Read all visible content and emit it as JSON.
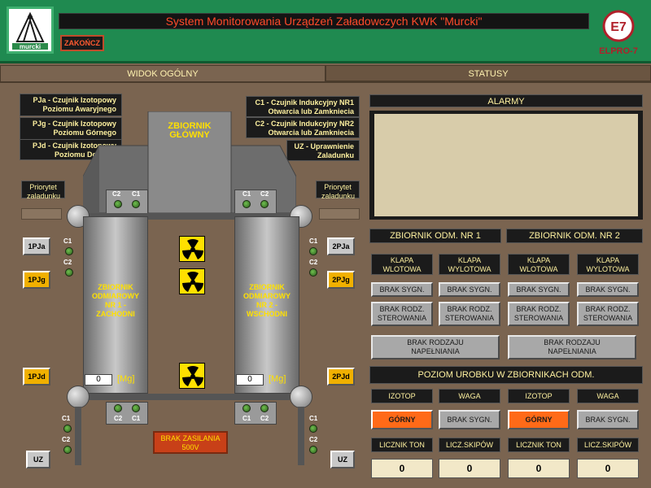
{
  "header": {
    "title": "System Monitorowania Urządzeń Załadowczych KWK \"Murcki\"",
    "exit_label": "ZAKOŃCZ",
    "logo_text": "murcki",
    "brand_logo_text": "ELPRO-7"
  },
  "tabs": [
    {
      "label": "WIDOK OGÓLNY",
      "active": true
    },
    {
      "label": "STATUSY",
      "active": false
    }
  ],
  "legend": {
    "pja": "PJa - Czujnik Izotopowy\nPoziomu Awaryjnego",
    "pjg": "PJg - Czujnik Izotopowy\nPoziomu Górnego",
    "pjd": "PJd - Czujnik Izotopowy\nPoziomu Dolnego",
    "c1": "C1 - Czujnik Indukcyjny NR1\nOtwarcia lub Zamkniecia",
    "c2": "C2 - Czujnik Indukcyjny NR2\nOtwarcia lub Zamkniecia",
    "uz": "UZ - Uprawnienie\nZaladunku"
  },
  "main_tank": {
    "label": "ZBIORNIK\nGŁÓWNY"
  },
  "priority": {
    "left": "Priorytet\nzaladunku",
    "right": "Priorytet\nzaladunku"
  },
  "tank_left": {
    "label": "ZBIORNIK\nODMIAROWY\nNR 1 -\nZACHODNI",
    "value": "0",
    "unit": "[Mg]"
  },
  "tank_right": {
    "label": "ZBIORNIK\nODMIAROWY\nNR 2 -\nWSCHODNI",
    "value": "0",
    "unit": "[Mg]"
  },
  "sensor_labels": {
    "c1": "C1",
    "c2": "C2"
  },
  "left_buttons": {
    "pja": "1PJa",
    "pjg": "1PJg",
    "pjd": "1PJd",
    "uz": "UZ"
  },
  "right_buttons": {
    "pja": "2PJa",
    "pjg": "2PJg",
    "pjd": "2PJd",
    "uz": "UZ"
  },
  "power": "BRAK ZASILANIA\n500V",
  "alarms": {
    "title": "ALARMY"
  },
  "tank1": {
    "title": "ZBIORNIK ODM. NR 1"
  },
  "tank2": {
    "title": "ZBIORNIK ODM. NR 2"
  },
  "klapa": {
    "in": "KLAPA\nWLOTOWA",
    "out": "KLAPA\nWYLOTOWA"
  },
  "brak_sygn": "BRAK SYGN.",
  "brak_rodz": "BRAK RODZ.\nSTEROWANIA",
  "brak_rodzaju": "BRAK RODZAJU\nNAPEŁNIANIA",
  "poziom": {
    "title": "POZIOM UROBKU W ZBIORNIKACH ODM."
  },
  "izotop": "IZOTOP",
  "waga": "WAGA",
  "gorny": "GÓRNY",
  "licznik": "LICZNIK TON",
  "skipow": "LICZ.SKIPÓW",
  "counts": [
    "0",
    "0",
    "0",
    "0"
  ],
  "colors": {
    "header": "#1f8a50",
    "panel": "#7a6450",
    "title_text": "#ff4a2a",
    "accent": "#ffe000",
    "active": "#ff6a18"
  }
}
